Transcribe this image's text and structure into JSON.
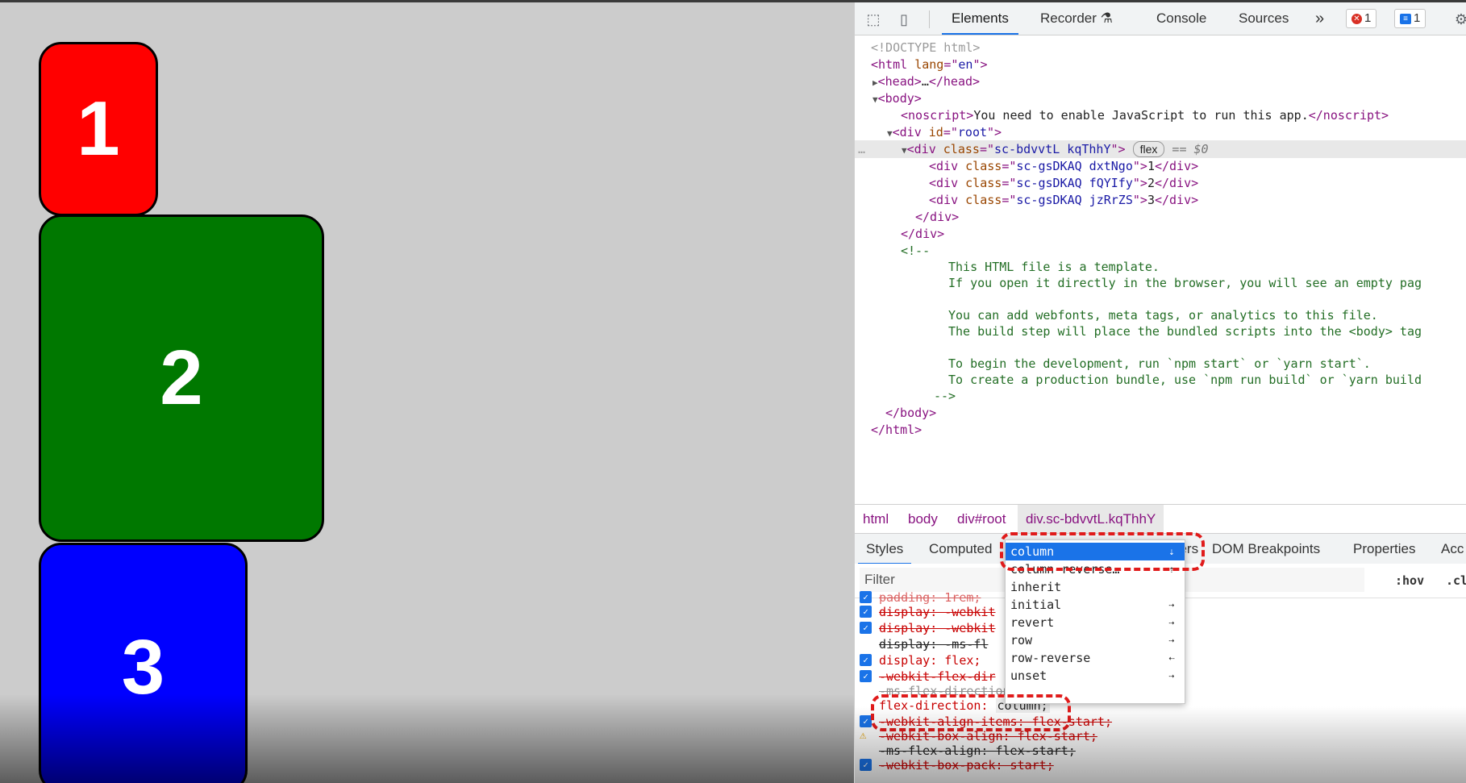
{
  "viewport": {
    "boxes": [
      {
        "label": "1",
        "color": "#ff0000"
      },
      {
        "label": "2",
        "color": "#007800"
      },
      {
        "label": "3",
        "color": "#0000ff"
      }
    ]
  },
  "devtools": {
    "tabs": [
      "Elements",
      "Recorder",
      "Console",
      "Sources"
    ],
    "more_tabs": "»",
    "error_count": "1",
    "message_count": "1",
    "dom": {
      "doctype": "<!DOCTYPE html>",
      "html_open": [
        "<html ",
        "lang",
        "=\"",
        "en",
        "\">"
      ],
      "head": [
        "<head>",
        "…",
        "</head>"
      ],
      "body_open": "<body>",
      "noscript": [
        "<noscript>",
        "You need to enable JavaScript to run this app.",
        "</noscript>"
      ],
      "root_div": [
        "<div ",
        "id",
        "=\"",
        "root",
        "\">"
      ],
      "flex_div": [
        "<div ",
        "class",
        "=\"",
        "sc-bdvvtL kqThhY",
        "\">"
      ],
      "flex_pill": "flex",
      "selected_marker": "== $0",
      "children": [
        {
          "cls": "sc-gsDKAQ dxtNgo",
          "text": "1"
        },
        {
          "cls": "sc-gsDKAQ fQYIfy",
          "text": "2"
        },
        {
          "cls": "sc-gsDKAQ jzRrZS",
          "text": "3"
        }
      ],
      "div_close": "</div>",
      "comment_open": "<!--",
      "comment_lines": [
        "This HTML file is a template.",
        "If you open it directly in the browser, you will see an empty pag",
        "",
        "You can add webfonts, meta tags, or analytics to this file.",
        "The build step will place the bundled scripts into the <body> tag",
        "",
        "To begin the development, run `npm start` or `yarn start`.",
        "To create a production bundle, use `npm run build` or `yarn build"
      ],
      "comment_close": "-->",
      "body_close": "</body>",
      "html_close": "</html>",
      "ellipsis": "…"
    },
    "breadcrumbs": [
      "html",
      "body",
      "div#root",
      "div.sc-bdvvtL.kqThhY"
    ],
    "subtabs": [
      "Styles",
      "Computed",
      "ners",
      "DOM Breakpoints",
      "Properties",
      "Acc"
    ],
    "filter_placeholder": "Filter",
    "hov": ":hov",
    "cls": ".cl",
    "styles": {
      "padding_cut": "padding: 1rem;",
      "display1": "display: -webkit",
      "display2": "display: -webkit",
      "display3": "display: -ms-fl",
      "display4": "display: flex;",
      "webkit_flex_dir": "-webkit-flex-dir",
      "flex_dir_faded": "-ms-flex-direction",
      "flex_direction_name": "flex-direction:",
      "flex_direction_value": "column;",
      "align_items": "-webkit-align-items: flex-start;",
      "box_align": "-webkit-box-align: flex-start;",
      "ms_flex_align": "-ms-flex-align: flex-start;",
      "box_pack": "-webkit-box-pack: start;"
    },
    "dropdown": {
      "options": [
        "column",
        "column-reverse…",
        "inherit",
        "initial",
        "revert",
        "row",
        "row-reverse",
        "unset"
      ],
      "selected": "column"
    }
  }
}
